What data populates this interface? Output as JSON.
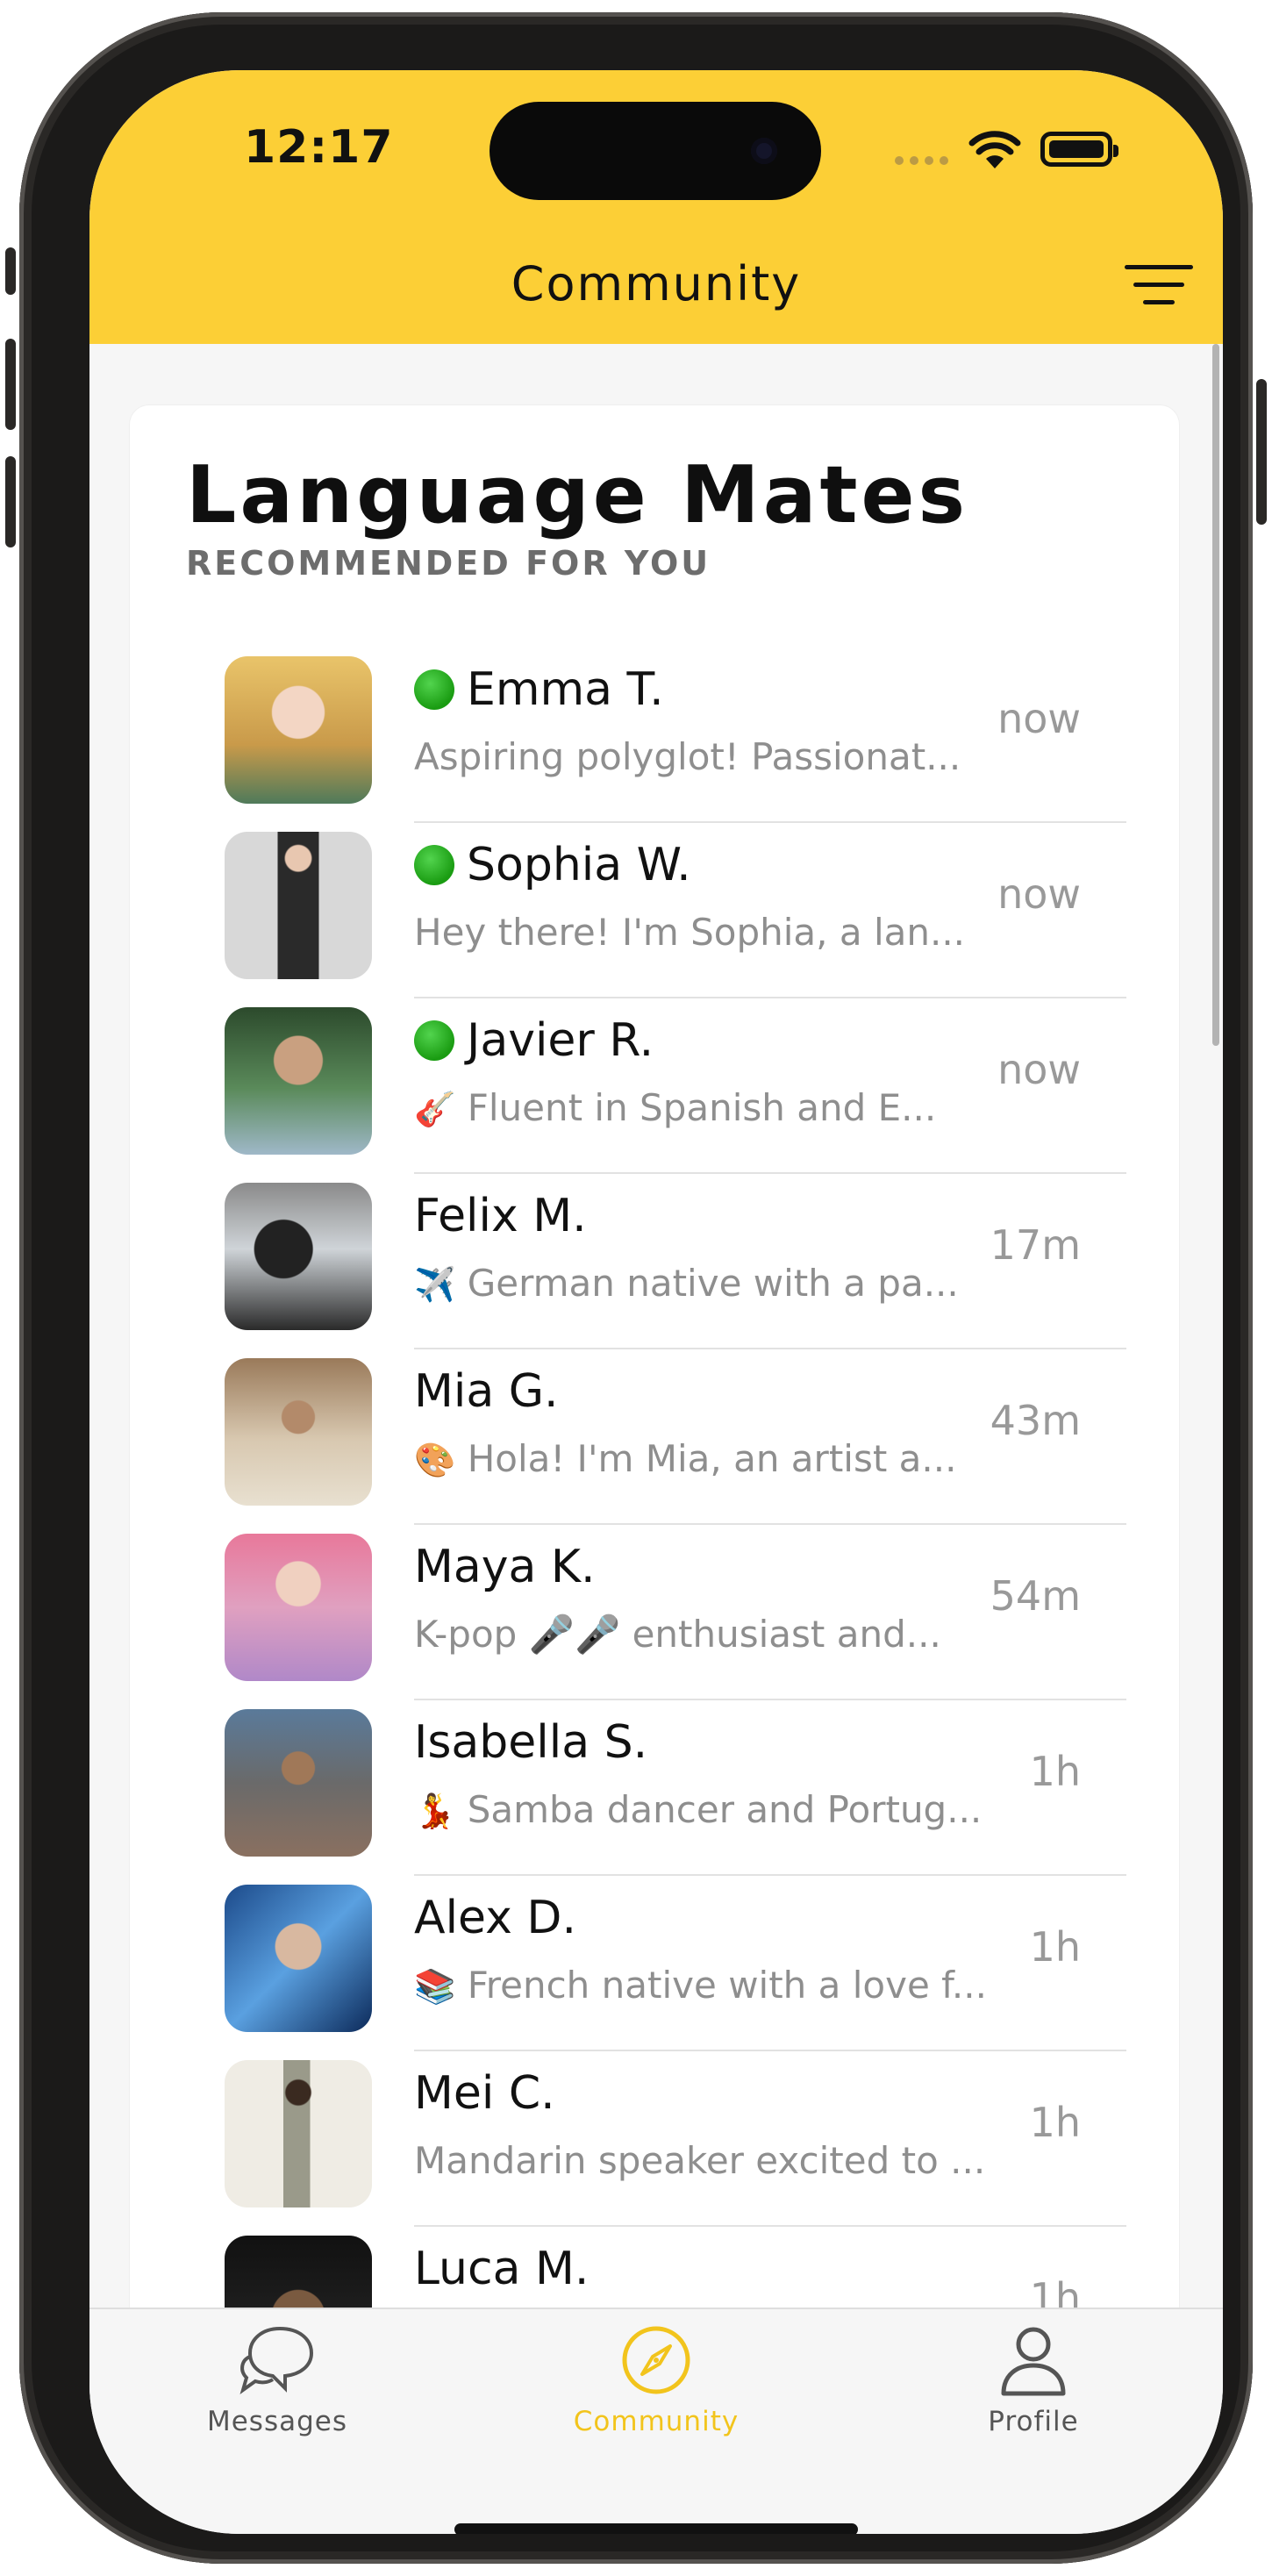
{
  "status_bar": {
    "time": "12:17"
  },
  "nav": {
    "title": "Community"
  },
  "section": {
    "title": "Language Mates",
    "subtitle": "RECOMMENDED FOR YOU"
  },
  "mates": [
    {
      "name": "Emma T.",
      "online": true,
      "emoji": "",
      "bio": "Aspiring polyglot! Passionat...",
      "ago": "now"
    },
    {
      "name": "Sophia W.",
      "online": true,
      "emoji": "",
      "bio": "Hey there! I'm Sophia, a lan...",
      "ago": "now"
    },
    {
      "name": "Javier R.",
      "online": true,
      "emoji": "🎸",
      "bio": "Fluent in Spanish and E...",
      "ago": "now"
    },
    {
      "name": "Felix M.",
      "online": false,
      "emoji": "✈️",
      "bio": "German native with a pa...",
      "ago": "17m"
    },
    {
      "name": "Mia G.",
      "online": false,
      "emoji": "🎨",
      "bio": "Hola! I'm Mia, an artist a...",
      "ago": "43m"
    },
    {
      "name": "Maya K.",
      "online": false,
      "emoji": "",
      "bio": "K-pop 🎤🎤 enthusiast and...",
      "ago": "54m"
    },
    {
      "name": "Isabella S.",
      "online": false,
      "emoji": "💃",
      "bio": "Samba dancer and Portug...",
      "ago": "1h"
    },
    {
      "name": "Alex D.",
      "online": false,
      "emoji": "📚",
      "bio": "French native with a love f...",
      "ago": "1h"
    },
    {
      "name": "Mei C.",
      "online": false,
      "emoji": "",
      "bio": "Mandarin speaker excited to ...",
      "ago": "1h"
    },
    {
      "name": "Luca M.",
      "online": false,
      "emoji": "",
      "bio": "",
      "ago": "1h"
    }
  ],
  "tabs": [
    {
      "label": "Messages",
      "icon": "chat-bubbles-icon",
      "active": false
    },
    {
      "label": "Community",
      "icon": "compass-icon",
      "active": true
    },
    {
      "label": "Profile",
      "icon": "person-icon",
      "active": false
    }
  ],
  "colors": {
    "accent": "#fccf36",
    "tab_active": "#f2c41c",
    "tab_inactive": "#555555",
    "online": "#22b01a"
  }
}
